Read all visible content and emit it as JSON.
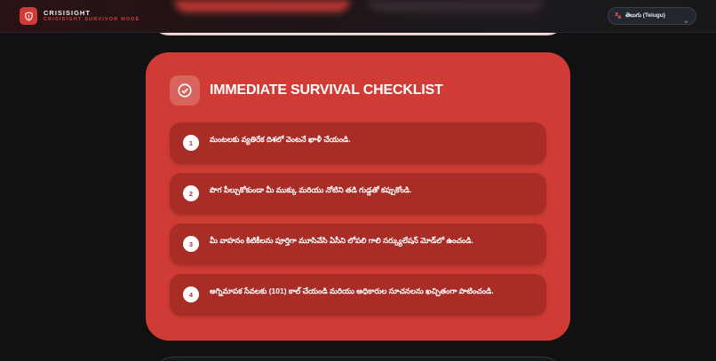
{
  "header": {
    "brand_name": "CRISISIGHT",
    "brand_sub": "CRISISIGHT SURVIVOR MODE",
    "language_label": "తెలుగు (Telugu)"
  },
  "checklist": {
    "title": "IMMEDIATE SURVIVAL CHECKLIST",
    "items": [
      {
        "num": "1",
        "text": "మంటలకు వ్యతిరేక దిశలో వెంటనే ఖాళీ చేయండి."
      },
      {
        "num": "2",
        "text": "పొగ పీల్చుకోకుండా మీ ముక్కు మరియు నోటిని తడి గుడ్డతో కప్పుకోండి."
      },
      {
        "num": "3",
        "text": "మీ వాహనం కిటికీలను పూర్తిగా మూసివేసి ఏసీని లోపలి గాలి సర్క్యులేషన్ మోడ్‌లో ఉంచండి."
      },
      {
        "num": "4",
        "text": "అగ్నిమాపక సేవలకు (101) కాల్ చేయండి మరియు అధికారుల సూచనలను ఖచ్చితంగా పాటించండి."
      }
    ]
  },
  "colors": {
    "accent": "#d03c35",
    "item_bg": "#a82d27",
    "background": "#111114"
  }
}
